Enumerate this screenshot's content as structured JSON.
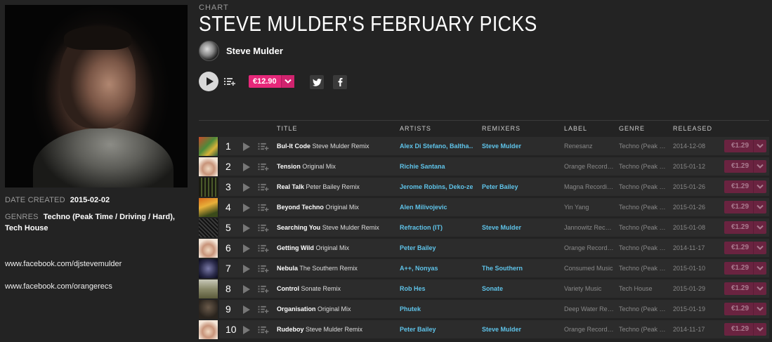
{
  "sidebar": {
    "date_label": "DATE CREATED",
    "date_value": "2015-02-02",
    "genres_label": "GENRES",
    "genres_value": "Techno (Peak Time / Driving / Hard), Tech House",
    "links": [
      "www.facebook.com/djstevemulder",
      "www.facebook.com/orangerecs"
    ]
  },
  "header": {
    "kicker": "CHART",
    "title": "STEVE MULDER'S FEBRUARY PICKS",
    "author": "Steve Mulder",
    "price": "€12.90"
  },
  "colors": {
    "accent": "#e6287a",
    "link": "#5fc4ea",
    "background": "#232323"
  },
  "table": {
    "columns": [
      "TITLE",
      "ARTISTS",
      "REMIXERS",
      "LABEL",
      "GENRE",
      "RELEASED"
    ],
    "rows": [
      {
        "num": "1",
        "title": "Bul-It Code",
        "mix": "Steve Mulder Remix",
        "artists": "Alex Di Stefano, Baltha…",
        "remixers": "Steve Mulder",
        "label": "Renesanz",
        "genre": "Techno (Peak …",
        "released": "2014-12-08",
        "price": "€1.29"
      },
      {
        "num": "2",
        "title": "Tension",
        "mix": "Original Mix",
        "artists": "Richie Santana",
        "remixers": "",
        "label": "Orange Record…",
        "genre": "Techno (Peak …",
        "released": "2015-01-12",
        "price": "€1.29"
      },
      {
        "num": "3",
        "title": "Real Talk",
        "mix": "Peter Bailey Remix",
        "artists": "Jerome Robins, Deko-ze",
        "remixers": "Peter Bailey",
        "label": "Magna Recordi…",
        "genre": "Techno (Peak …",
        "released": "2015-01-26",
        "price": "€1.29"
      },
      {
        "num": "4",
        "title": "Beyond Techno",
        "mix": "Original Mix",
        "artists": "Alen Milivojevic",
        "remixers": "",
        "label": "Yin Yang",
        "genre": "Techno (Peak …",
        "released": "2015-01-26",
        "price": "€1.29"
      },
      {
        "num": "5",
        "title": "Searching You",
        "mix": "Steve Mulder Remix",
        "artists": "Refraction (IT)",
        "remixers": "Steve Mulder",
        "label": "Jannowitz Rec…",
        "genre": "Techno (Peak …",
        "released": "2015-01-08",
        "price": "€1.29"
      },
      {
        "num": "6",
        "title": "Getting Wild",
        "mix": "Original Mix",
        "artists": "Peter Bailey",
        "remixers": "",
        "label": "Orange Record…",
        "genre": "Techno (Peak …",
        "released": "2014-11-17",
        "price": "€1.29"
      },
      {
        "num": "7",
        "title": "Nebula",
        "mix": "The Southern Remix",
        "artists": "A++, Nonyas",
        "remixers": "The Southern",
        "label": "Consumed Music",
        "genre": "Techno (Peak …",
        "released": "2015-01-10",
        "price": "€1.29"
      },
      {
        "num": "8",
        "title": "Control",
        "mix": "Sonate Remix",
        "artists": "Rob Hes",
        "remixers": "Sonate",
        "label": "Variety Music",
        "genre": "Tech House",
        "released": "2015-01-29",
        "price": "€1.29"
      },
      {
        "num": "9",
        "title": "Organisation",
        "mix": "Original Mix",
        "artists": "Phutek",
        "remixers": "",
        "label": "Deep Water Re…",
        "genre": "Techno (Peak …",
        "released": "2015-01-19",
        "price": "€1.29"
      },
      {
        "num": "10",
        "title": "Rudeboy",
        "mix": "Steve Mulder Remix",
        "artists": "Peter Bailey",
        "remixers": "Steve Mulder",
        "label": "Orange Record…",
        "genre": "Techno (Peak …",
        "released": "2014-11-17",
        "price": "€1.29"
      }
    ]
  }
}
